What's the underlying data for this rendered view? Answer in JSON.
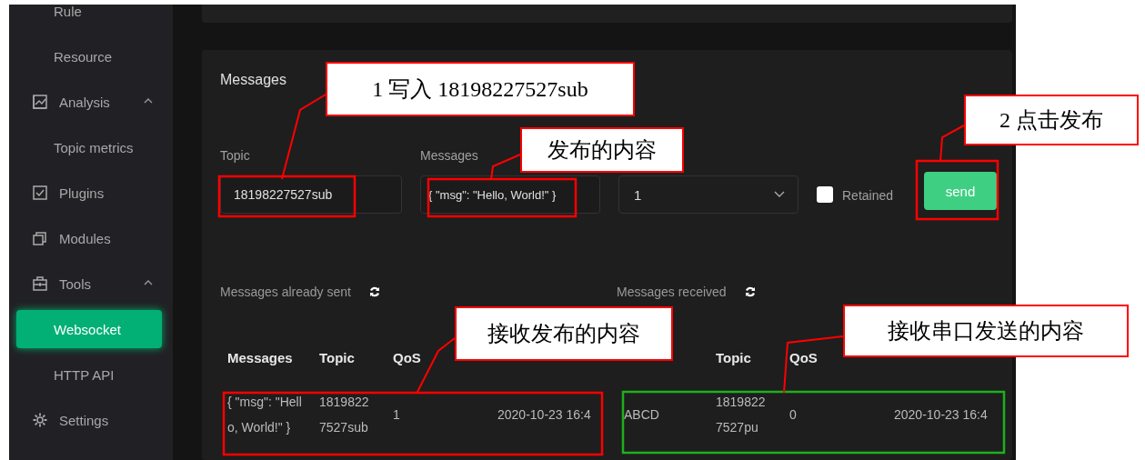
{
  "sidebar": {
    "items": [
      {
        "label": "Rule",
        "kind": "sub",
        "selected": false
      },
      {
        "label": "Resource",
        "kind": "sub",
        "selected": false
      },
      {
        "label": "Analysis",
        "kind": "group",
        "expanded": true,
        "selected": false
      },
      {
        "label": "Topic metrics",
        "kind": "sub",
        "selected": false
      },
      {
        "label": "Plugins",
        "kind": "link",
        "selected": false
      },
      {
        "label": "Modules",
        "kind": "link",
        "selected": false
      },
      {
        "label": "Tools",
        "kind": "group",
        "expanded": true,
        "selected": false
      },
      {
        "label": "Websocket",
        "kind": "sub",
        "selected": true
      },
      {
        "label": "HTTP API",
        "kind": "sub",
        "selected": false
      },
      {
        "label": "Settings",
        "kind": "link",
        "selected": false
      }
    ]
  },
  "publish": {
    "title": "Messages",
    "topic": {
      "label": "Topic",
      "value": "18198227527sub"
    },
    "message": {
      "label": "Messages",
      "value": "{ \"msg\": \"Hello, World!\" }"
    },
    "qos": {
      "value": "1"
    },
    "retained": {
      "label": "Retained",
      "checked": false
    },
    "send": "send"
  },
  "sent": {
    "title": "Messages already sent",
    "columns": [
      "Messages",
      "Topic",
      "QoS"
    ],
    "rows": [
      {
        "message": "{ \"msg\": \"Hello, World!\" }",
        "topic": "18198227527sub",
        "qos": "1",
        "time": "2020-10-23 16:4"
      }
    ]
  },
  "received": {
    "title": "Messages received",
    "columns": [
      "Topic",
      "QoS"
    ],
    "rows": [
      {
        "message": "ABCD",
        "topic": "18198227527pu",
        "qos": "0",
        "time": "2020-10-23 16:4"
      }
    ]
  },
  "callouts": [
    {
      "text": "1 写入 18198227527sub"
    },
    {
      "text": "发布的内容"
    },
    {
      "text": "2 点击发布"
    },
    {
      "text": "接收发布的内容"
    },
    {
      "text": "接收串口发送的内容"
    }
  ]
}
